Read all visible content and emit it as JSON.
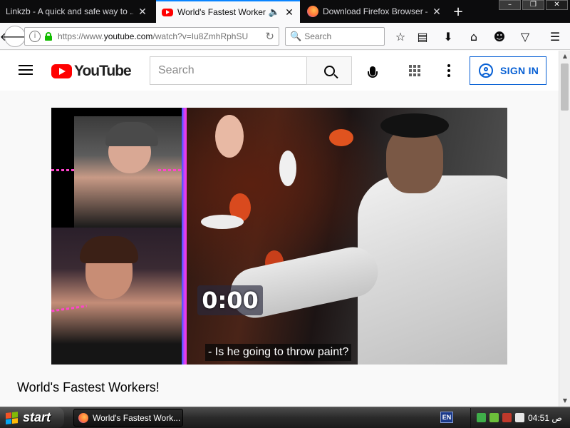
{
  "browser": {
    "tabs": [
      {
        "title": "Linkzb - A quick and safe way to ...",
        "active": false,
        "icon": "none"
      },
      {
        "title": "World's Fastest Workers!",
        "active": true,
        "icon": "youtube-icon",
        "audio": true
      },
      {
        "title": "Download Firefox Browser — ...",
        "active": false,
        "icon": "firefox-icon"
      }
    ],
    "new_tab_symbol": "+",
    "window_controls": {
      "minimize": "–",
      "maximize": "❐",
      "close": "✕"
    },
    "url_prefix": "https://www.",
    "url_domain": "youtube.com",
    "url_path": "/watch?v=Iu8ZmhRphSU",
    "search_placeholder": "Search",
    "toolbar_icons": [
      "star-icon",
      "library-icon",
      "download-icon",
      "home-icon",
      "smiley-icon",
      "pocket-icon",
      "menu-icon"
    ]
  },
  "youtube": {
    "logo_text": "YouTube",
    "search_placeholder": "Search",
    "sign_in_label": "SIGN IN",
    "brand_color": "#ff0000",
    "link_color": "#065fd4"
  },
  "video": {
    "timer_text": "0:00",
    "caption_text": "- Is he going to throw paint?",
    "title": "World's Fastest Workers!"
  },
  "taskbar": {
    "start_label": "start",
    "task_label": "World's Fastest Work...",
    "language": "EN",
    "clock": "04:51 ص"
  }
}
